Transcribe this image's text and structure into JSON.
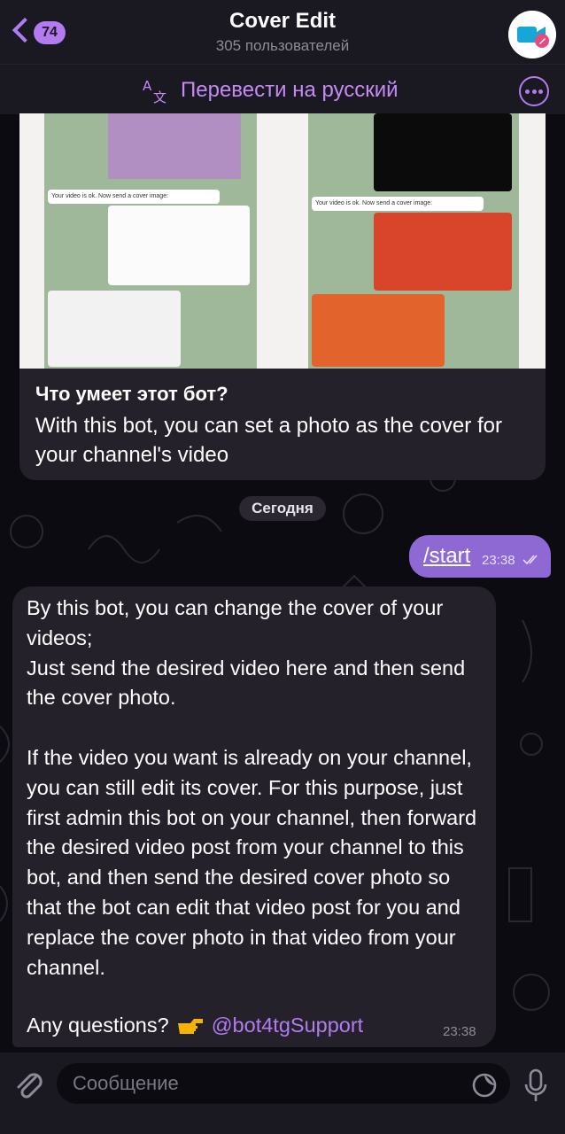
{
  "header": {
    "back_badge": "74",
    "title": "Cover Edit",
    "subtitle": "305 пользователей"
  },
  "translate_bar": {
    "label": "Перевести на русский"
  },
  "intro": {
    "heading": "Что умеет этот бот?",
    "text": "With this bot, you can set a photo as the cover for your channel's video",
    "image_caption_left": "Your video is ok. Now send a cover image:",
    "image_caption_right": "Your video is ok. Now send a cover image:"
  },
  "date_chip": "Сегодня",
  "outgoing": {
    "text": "/start",
    "time": "23:38"
  },
  "incoming": {
    "text": "By this bot, you can change the cover of your videos;\nJust send the desired video here and then send the cover photo.\n\nIf the video you want is already on your channel, you can still edit its cover. For this purpose, just first admin this bot on your channel, then forward the desired video post from your channel to this bot, and then send the desired cover photo so that the bot can edit that video post for you and replace the cover photo in that video from your channel.",
    "question": "Any questions?",
    "mention": "@bot4tgSupport",
    "time": "23:38"
  },
  "input": {
    "placeholder": "Сообщение"
  },
  "colors": {
    "accent": "#b27cf0",
    "outgoing_bubble": "#8e69d3",
    "incoming_bubble": "#24212b",
    "bar_bg": "#1a1820"
  },
  "icons": [
    "chevron-left-icon",
    "translate-icon",
    "more-icon",
    "checkmarks-icon",
    "pointing-hand-icon",
    "paperclip-icon",
    "sticker-icon",
    "microphone-icon"
  ]
}
